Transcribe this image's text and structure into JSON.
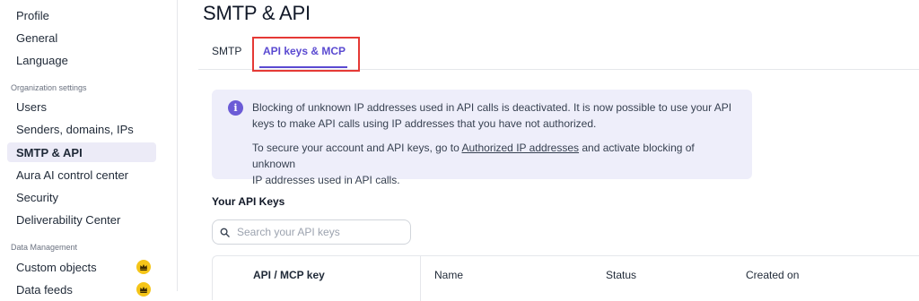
{
  "sidebar": {
    "items_top": [
      {
        "label": "Profile"
      },
      {
        "label": "General"
      },
      {
        "label": "Language"
      }
    ],
    "org_section_label": "Organization settings",
    "org_items": [
      {
        "label": "Users"
      },
      {
        "label": "Senders, domains, IPs"
      },
      {
        "label": "SMTP & API",
        "active": true
      },
      {
        "label": "Aura AI control center"
      },
      {
        "label": "Security"
      },
      {
        "label": "Deliverability Center"
      }
    ],
    "data_section_label": "Data Management",
    "data_items": [
      {
        "label": "Custom objects",
        "icon": "crown-icon"
      },
      {
        "label": "Data feeds",
        "icon": "crown-icon"
      }
    ]
  },
  "main": {
    "title": "SMTP & API",
    "tabs": [
      {
        "label": "SMTP"
      },
      {
        "label": "API keys & MCP",
        "active": true
      }
    ],
    "info": {
      "icon": "info-icon",
      "icon_glyph": "i",
      "line1": "Blocking of unknown IP addresses used in API calls is deactivated. It is now possible to use your API",
      "line2": "keys to make API calls using IP addresses that you have not authorized.",
      "line3_before": "To secure your account and API keys, go to ",
      "line3_link": "Authorized IP addresses",
      "line3_after": " and activate blocking of unknown",
      "line4": "IP addresses used in API calls."
    },
    "keys_title": "Your API Keys",
    "search": {
      "placeholder": "Search your API keys",
      "value": ""
    },
    "table": {
      "headers": [
        "API / MCP key",
        "Name",
        "Status",
        "Created on"
      ]
    }
  },
  "colors": {
    "accent": "#5a4ad1",
    "active_nav_bg": "#ecebf7",
    "info_bg": "#eeeefa",
    "highlight_border": "#e53935",
    "crown": "#f5c518"
  }
}
